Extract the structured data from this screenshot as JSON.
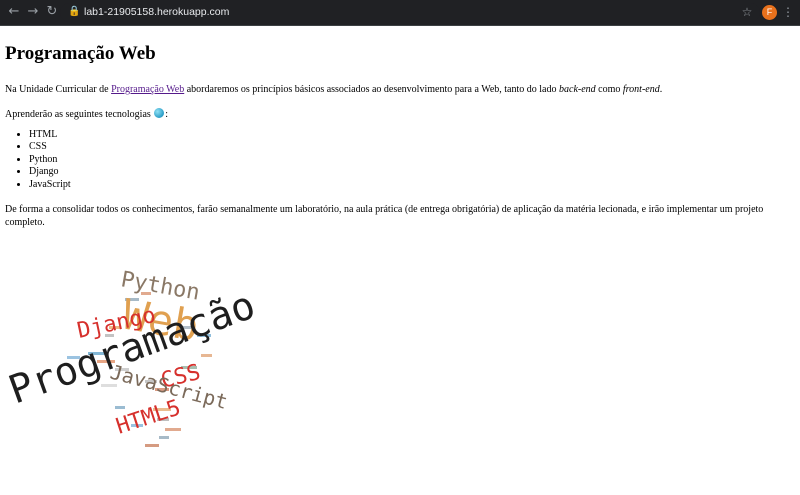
{
  "browser": {
    "url": "lab1-21905158.herokuapp.com",
    "profile_initial": "F",
    "back_icon": "arrow-left-icon",
    "forward_icon": "arrow-right-icon",
    "reload_icon": "reload-icon"
  },
  "page": {
    "title": "Programação Web",
    "intro_before_link": "Na Unidade Curricular de ",
    "intro_link": "Programação Web",
    "intro_after_link": " abordaremos os princípios básicos associados ao desenvolvimento para a Web, tanto do lado ",
    "intro_backend": "back-end",
    "intro_between": " como ",
    "intro_frontend": "front-end",
    "intro_end": ".",
    "tech_intro_before": "Aprenderão as seguintes tecnologias ",
    "tech_intro_after": ":",
    "technologies": [
      "HTML",
      "CSS",
      "Python",
      "Django",
      "JavaScript"
    ],
    "closing": "De forma a consolidar todos os conhecimentos, farão semanalmente um laboratório, na aula prática (de entrega obrigatória) de aplicação da matéria lecionada, e irão implementar um projeto completo."
  },
  "wordcloud": {
    "words": [
      {
        "text": "Python",
        "color": "#8a7866"
      },
      {
        "text": "Web",
        "color": "#e0a050"
      },
      {
        "text": "Django",
        "color": "#d6302c"
      },
      {
        "text": "Programação",
        "color": "#1e1e1e"
      },
      {
        "text": "CSS",
        "color": "#d6302c"
      },
      {
        "text": "JavaScript",
        "color": "#7b6a5a"
      },
      {
        "text": "HTML5",
        "color": "#d6302c"
      }
    ]
  }
}
